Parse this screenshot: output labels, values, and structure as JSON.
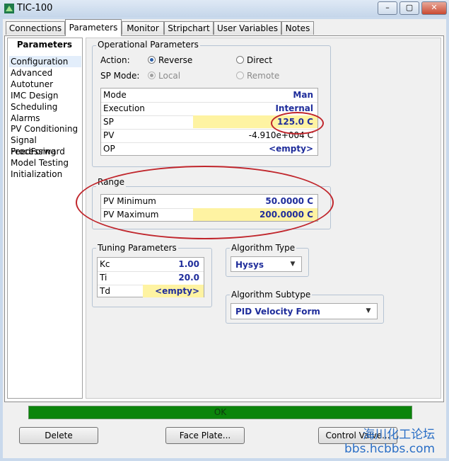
{
  "window": {
    "title": "TIC-100"
  },
  "tabs": [
    "Connections",
    "Parameters",
    "Monitor",
    "Stripchart",
    "User Variables",
    "Notes"
  ],
  "nav": {
    "header": "Parameters",
    "items": [
      "Configuration",
      "Advanced",
      "Autotuner",
      "IMC Design",
      "Scheduling",
      "Alarms",
      "PV Conditioning",
      "Signal Processing",
      "FeedForward",
      "Model Testing",
      "Initialization"
    ]
  },
  "operational": {
    "legend": "Operational Parameters",
    "action_label": "Action:",
    "reverse": "Reverse",
    "direct": "Direct",
    "spmode_label": "SP Mode:",
    "local": "Local",
    "remote": "Remote",
    "rows": [
      {
        "label": "Mode",
        "value": "Man"
      },
      {
        "label": "Execution",
        "value": "Internal"
      },
      {
        "label": "SP",
        "value": "125.0 C"
      },
      {
        "label": "PV",
        "value": "-4.910e+004 C"
      },
      {
        "label": "OP",
        "value": "<empty>"
      }
    ]
  },
  "range": {
    "legend": "Range",
    "rows": [
      {
        "label": "PV Minimum",
        "value": "50.0000 C"
      },
      {
        "label": "PV Maximum",
        "value": "200.0000 C"
      }
    ]
  },
  "tuning": {
    "legend": "Tuning Parameters",
    "rows": [
      {
        "label": "Kc",
        "value": "1.00"
      },
      {
        "label": "Ti",
        "value": "20.0"
      },
      {
        "label": "Td",
        "value": "<empty>"
      }
    ]
  },
  "algorithm": {
    "legend": "Algorithm Type",
    "value": "Hysys"
  },
  "subtype": {
    "legend": "Algorithm Subtype",
    "value": "PID Velocity Form"
  },
  "status": "OK",
  "buttons": {
    "delete": "Delete",
    "faceplate": "Face Plate...",
    "control": "Control Valve..."
  },
  "watermark": {
    "line1": "海川化工论坛",
    "line2": "bbs.hcbbs.com"
  },
  "colors": {
    "value_text": "#1f2d9b",
    "highlight": "#fef3a2",
    "status_ok": "#0b850b",
    "annotation": "#c0262c"
  }
}
